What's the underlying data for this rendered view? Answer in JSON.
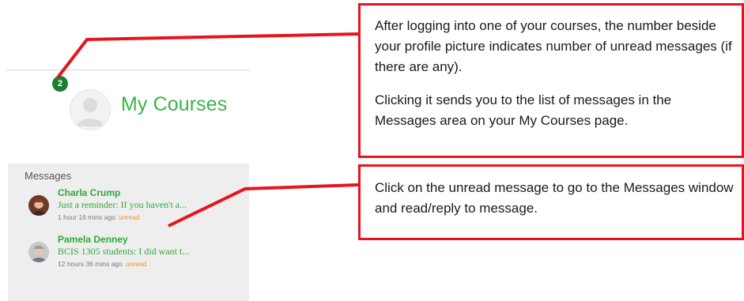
{
  "header": {
    "badge_count": "2",
    "title": "My Courses"
  },
  "messages": {
    "heading": "Messages",
    "items": [
      {
        "sender": "Charla Crump",
        "preview": "Just a reminder:  If you haven't a...",
        "time": "1 hour 16 mins ago",
        "status": "unread"
      },
      {
        "sender": "Pamela Denney",
        "preview": "BCIS 1305 students: I did want t...",
        "time": "12 hours 36 mins ago",
        "status": "unread"
      }
    ]
  },
  "callouts": {
    "top": {
      "paragraph1": "After logging into one of your courses, the number beside your profile picture indicates number of unread messages (if there are any).",
      "paragraph2": "Clicking it sends you to the list of messages in the Messages area on your My Courses page."
    },
    "bottom": {
      "paragraph1": "Click on the unread message to go to the Messages window and read/reply to message."
    }
  },
  "colors": {
    "accent_green": "#3bb44a",
    "badge_green": "#1b7f32",
    "unread_orange": "#f2921d",
    "callout_red": "#e8141c"
  },
  "icons": {
    "avatar": "user-silhouette-icon",
    "badge": "notification-badge"
  }
}
